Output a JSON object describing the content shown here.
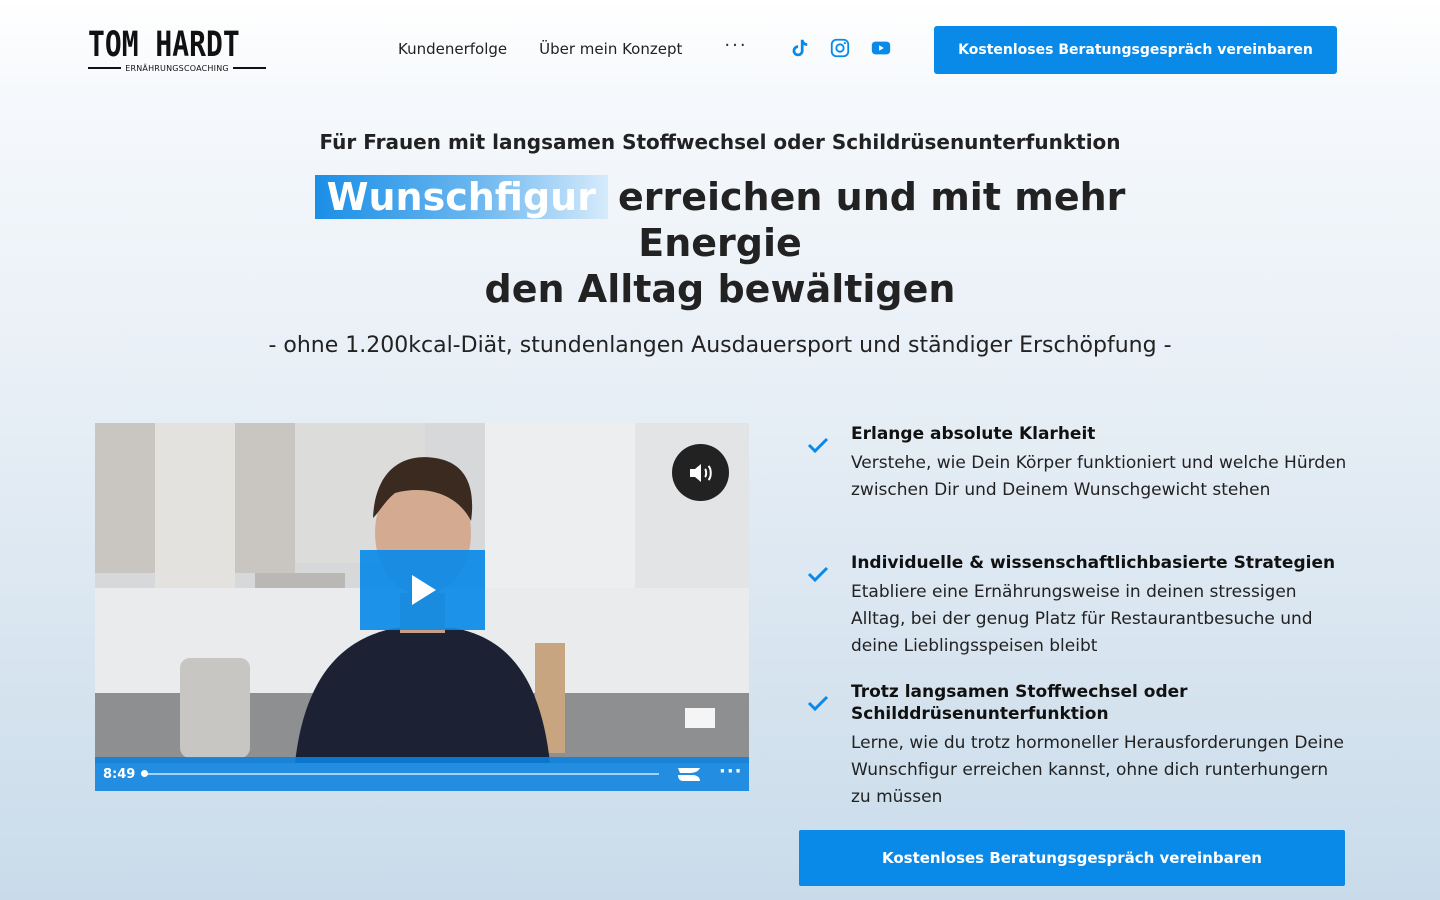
{
  "header": {
    "logo": {
      "name": "TOM HARDT",
      "tagline": "ERNÄHRUNGSCOACHING"
    },
    "nav": [
      {
        "label": "Kundenerfolge"
      },
      {
        "label": "Über mein Konzept"
      }
    ],
    "more_label": "···",
    "socials": [
      {
        "icon": "tiktok-icon"
      },
      {
        "icon": "instagram-icon"
      },
      {
        "icon": "youtube-icon"
      }
    ],
    "cta_label": "Kostenloses Beratungsgespräch vereinbaren"
  },
  "hero": {
    "kicker": "Für Frauen mit langsamen Stoffwechsel oder Schildrüsenunterfunktion",
    "highlight": "Wunschfigur",
    "headline_line1": "erreichen und mit mehr Energie",
    "headline_line2": "den Alltag bewältigen",
    "subline": "- ohne 1.200kcal-Diät, stundenlangen Ausdauersport und ständiger Erschöpfung -"
  },
  "video": {
    "duration": "8:49",
    "progress": 0.0,
    "controls_more": "···"
  },
  "features": [
    {
      "title": "Erlange absolute Klarheit",
      "text": "Verstehe, wie Dein Körper funktioniert und welche Hürden zwischen Dir und Deinem Wunschgewicht stehen"
    },
    {
      "title": "Individuelle & wissenschaftlichbasierte Strategien",
      "text": "Etabliere eine Ernährungsweise in deinen stressigen Alltag, bei der genug Platz für Restaurantbesuche und deine Lieblingsspeisen bleibt"
    },
    {
      "title": "Trotz  langsamen Stoffwechsel oder Schilddrüsenunterfunktion",
      "text": "Lerne, wie du trotz hormoneller Herausforderungen Deine Wunschfigur erreichen kannst, ohne dich runterhungern zu müssen"
    }
  ],
  "cta_bottom_label": "Kostenloses Beratungsgespräch vereinbaren",
  "colors": {
    "accent": "#0a8ae8",
    "text": "#1a1a1a"
  }
}
